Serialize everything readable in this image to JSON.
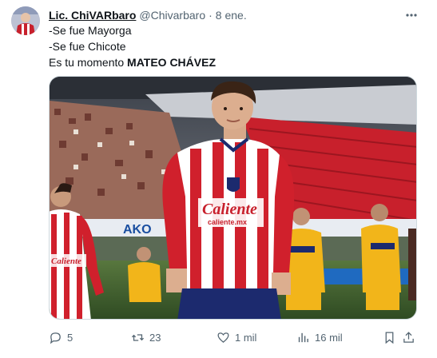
{
  "post": {
    "author_name": "Lic. ChiVARbaro",
    "author_handle": "@Chivarbaro",
    "separator": "·",
    "timestamp": "8 ene.",
    "lines": [
      "-Se fue Mayorga",
      "-Se fue Chicote"
    ],
    "last_line_prefix": "Es tu momento ",
    "last_line_bold": "MATEO CHÁVEZ"
  },
  "media": {
    "jersey_sponsor": "Caliente",
    "jersey_sponsor_url": "caliente.mx",
    "board_text": "AKO"
  },
  "actions": {
    "replies": "5",
    "reposts": "23",
    "likes": "1 mil",
    "views": "16 mil"
  },
  "colors": {
    "text": "#0f1419",
    "secondary": "#536471",
    "chivas_red": "#d0202c",
    "chivas_blue": "#1c2a6e",
    "tigres_yellow": "#f2b51a"
  }
}
